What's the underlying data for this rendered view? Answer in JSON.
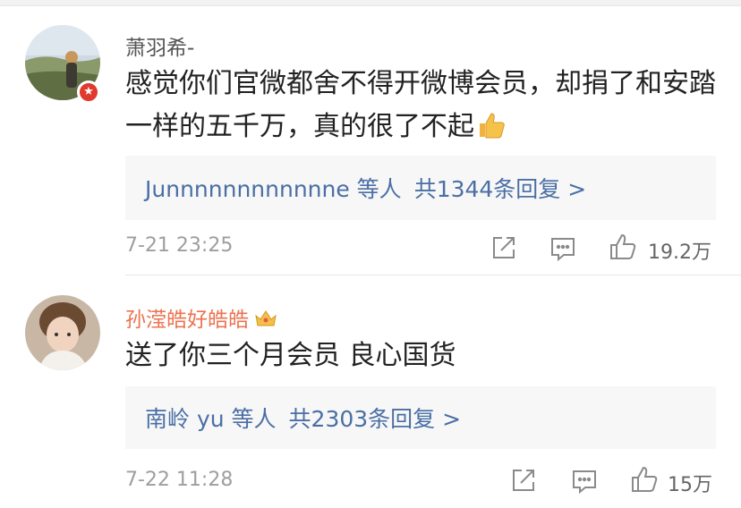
{
  "comments": [
    {
      "username": "萧羽希-",
      "text": "感觉你们官微都舍不得开微博会员，却捐了和安踏一样的五千万，真的很了不起",
      "emoji": "thumbs-up-icon",
      "replies_who": "Junnnnnnnnnnnne 等人",
      "replies_count": "共1344条回复 >",
      "time": "7-21 23:25",
      "likes": "19.2万",
      "badge_icon": "verified-star-icon"
    },
    {
      "username": "孙滢皓好皓皓",
      "text": "送了你三个月会员 良心国货",
      "replies_who": "南岭 yu 等人",
      "replies_count": "共2303条回复 >",
      "time": "7-22 11:28",
      "likes": "15万",
      "badge_icon": "crown-icon"
    }
  ],
  "colors": {
    "username_vip": "#eb7350",
    "reply_link": "#4a6fa5",
    "meta_gray": "#9e9e9e"
  }
}
